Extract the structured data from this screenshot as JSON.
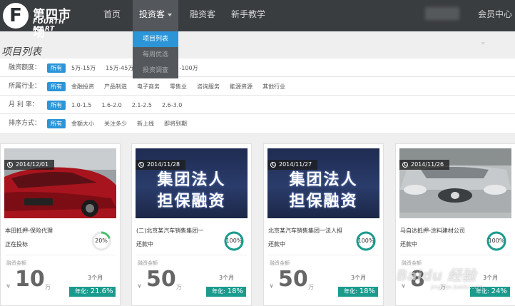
{
  "brand": {
    "name_cn": "第四市场",
    "name_en": "FOURTH MART",
    "letter": "F"
  },
  "nav": {
    "items": [
      "首页",
      "投资客",
      "融资客",
      "新手教学"
    ],
    "member": "会员中心"
  },
  "dropdown": [
    "项目列表",
    "每周优选",
    "投资调查"
  ],
  "page_title": "项目列表",
  "filters": [
    {
      "label": "融资额度：",
      "options": [
        "所有",
        "5万-15万",
        "15万-45万",
        "",
        "-100万"
      ]
    },
    {
      "label": "所属行业：",
      "options": [
        "所有",
        "金融投资",
        "产品制造",
        "电子商务",
        "零售业",
        "咨询服务",
        "能源资源",
        "其他行业"
      ]
    },
    {
      "label": "月 利 率：",
      "options": [
        "所有",
        "1.0-1.5",
        "1.6-2.0",
        "2.1-2.5",
        "2.6-3.0"
      ]
    },
    {
      "label": "排序方式：",
      "options": [
        "所有",
        "金额大小",
        "关注多少",
        "新上线",
        "即将到期"
      ]
    }
  ],
  "cards": [
    {
      "date": "2014/12/01",
      "title": "本田抵押-保险代理",
      "status": "正在投标",
      "progress": 20,
      "progress_text": "20%",
      "amount_label": "融资金额",
      "currency": "¥",
      "amount": "10",
      "unit": "万",
      "term": "3个月",
      "rate_label": "年化:",
      "rate": "21.6%",
      "image": "red-car"
    },
    {
      "date": "2014/11/28",
      "title": "(二)北京某汽车销售集团一",
      "status": "还款中",
      "progress": 100,
      "progress_text": "100%",
      "amount_label": "融资金额",
      "currency": "¥",
      "amount": "50",
      "unit": "万",
      "term": "3个月",
      "rate_label": "年化:",
      "rate": "18%",
      "image": "banner",
      "banner_lines": [
        "集团法人",
        "担保融资"
      ]
    },
    {
      "date": "2014/11/27",
      "title": "北京某汽车销售集团一法人担",
      "status": "还款中",
      "progress": 100,
      "progress_text": "100%",
      "amount_label": "融资金额",
      "currency": "¥",
      "amount": "50",
      "unit": "万",
      "term": "3个月",
      "rate_label": "年化:",
      "rate": "18%",
      "image": "banner",
      "banner_lines": [
        "集团法人",
        "担保融资"
      ]
    },
    {
      "date": "2014/11/26",
      "title": "马自达抵押-涂料建材公司",
      "status": "还款中",
      "progress": 100,
      "progress_text": "100%",
      "amount_label": "融资金额",
      "currency": "¥",
      "amount": "8",
      "unit": "万",
      "term": "3个月",
      "rate_label": "年化:",
      "rate": "24%",
      "image": "silver-car"
    }
  ],
  "watermark": {
    "text": "Baidu 经验",
    "sub": "jingyan.baidu.com"
  },
  "colors": {
    "nav_bg": "#3a3d40",
    "accent_blue": "#2b95d8",
    "rate_teal": "#1a9b8e",
    "ring_teal": "#1a9b8e",
    "ring_green": "#4cc06d"
  }
}
